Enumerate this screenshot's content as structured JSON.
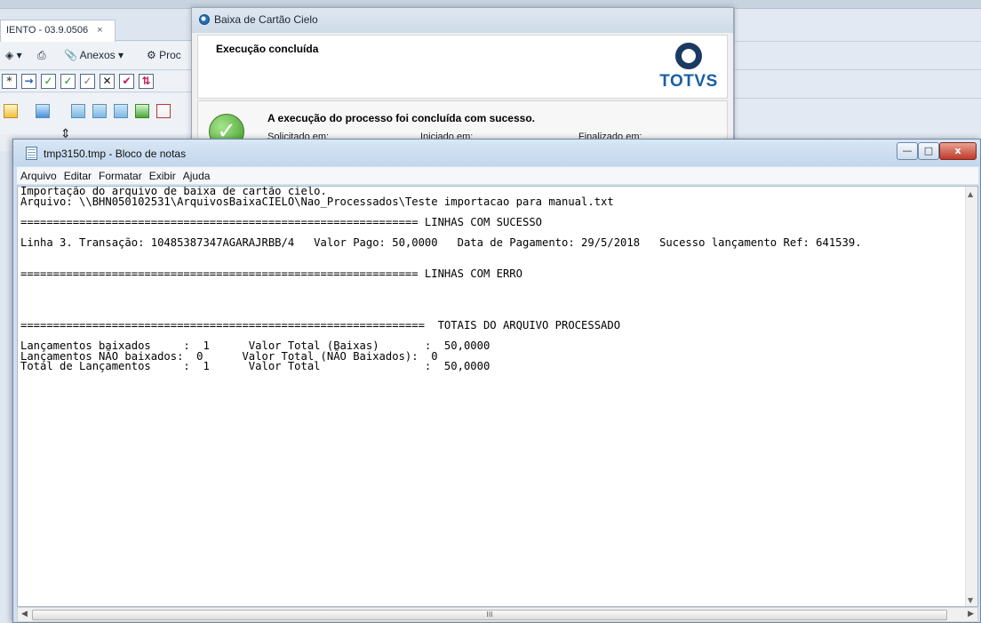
{
  "background_app": {
    "tab_label": "IENTO - 03.9.0506",
    "tab_close": "×",
    "toolbar_items": [
      "Anexos",
      "Proc"
    ],
    "check_buttons": [
      "→",
      "✓",
      "✓",
      "✓",
      "✕"
    ]
  },
  "dialog": {
    "title": "Baixa de Cartão Cielo",
    "header": "Execução concluída",
    "logo_text": "TOTVS",
    "message": "A execução do processo foi concluída com sucesso.",
    "labels": {
      "requested": "Solicitado em:",
      "started": "Iniciado em:",
      "finished": "Finalizado em:"
    }
  },
  "notepad": {
    "title": "tmp3150.tmp - Bloco de notas",
    "window_buttons": {
      "minimize": "—",
      "maximize": "□",
      "close": "x"
    },
    "menu": [
      "Arquivo",
      "Editar",
      "Formatar",
      "Exibir",
      "Ajuda"
    ],
    "scroll_thumb_grip": "III",
    "content": "Importação do arquivo de baixa de cartão cielo.\nArquivo: \\\\BHN050102531\\ArquivosBaixaCIELO\\Nao_Processados\\Teste importacao para manual.txt\n\n============================================================= LINHAS COM SUCESSO\n\nLinha 3. Transação: 10485387347AGARAJRBB/4   Valor Pago: 50,0000   Data de Pagamento: 29/5/2018   Sucesso lançamento Ref: 641539.\n\n\n============================================================= LINHAS COM ERRO\n\n\n\n\n==============================================================  TOTAIS DO ARQUIVO PROCESSADO\n\nLançamentos baixados     :  1      Valor Total (Baixas)       :  50,0000\nLançamentos NÃO baixados:  0      Valor Total (NÃO Baixados):  0\nTotal de Lançamentos     :  1      Valor Total                :  50,0000"
  }
}
